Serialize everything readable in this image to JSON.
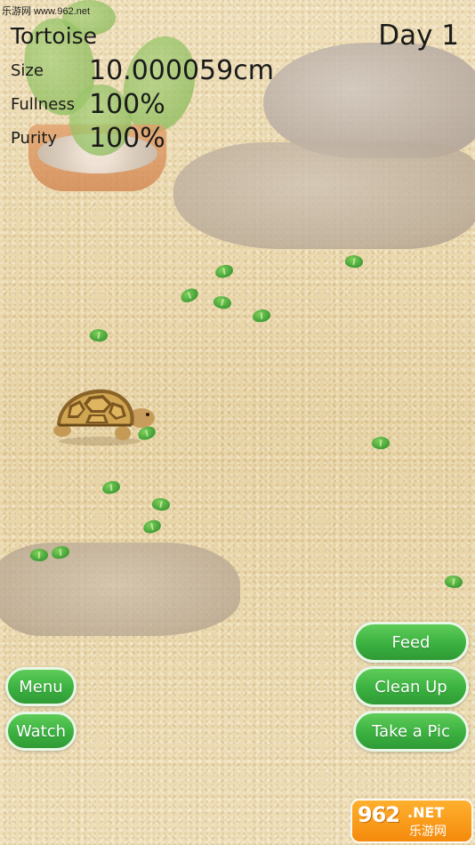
{
  "watermark": "乐游网 www.962.net",
  "hud": {
    "title": "Tortoise",
    "day": "Day 1",
    "size_label": "Size",
    "size_value": "10.000059cm",
    "fullness_label": "Fullness",
    "fullness_value": "100%",
    "purity_label": "Purity",
    "purity_value": "100%"
  },
  "buttons": {
    "menu": "Menu",
    "watch": "Watch",
    "feed": "Feed",
    "clean_up": "Clean Up",
    "take_pic": "Take a Pic"
  },
  "logo": {
    "number": "962",
    "net": ".NET",
    "cn": "乐游网"
  },
  "colors": {
    "button_green": "#3bb140",
    "leaf_green": "#49a53a",
    "sand": "#e9d6a8",
    "logo_orange": "#f48a0c"
  },
  "icons": [
    "leaf-icon",
    "tortoise-icon",
    "cactus-icon"
  ]
}
